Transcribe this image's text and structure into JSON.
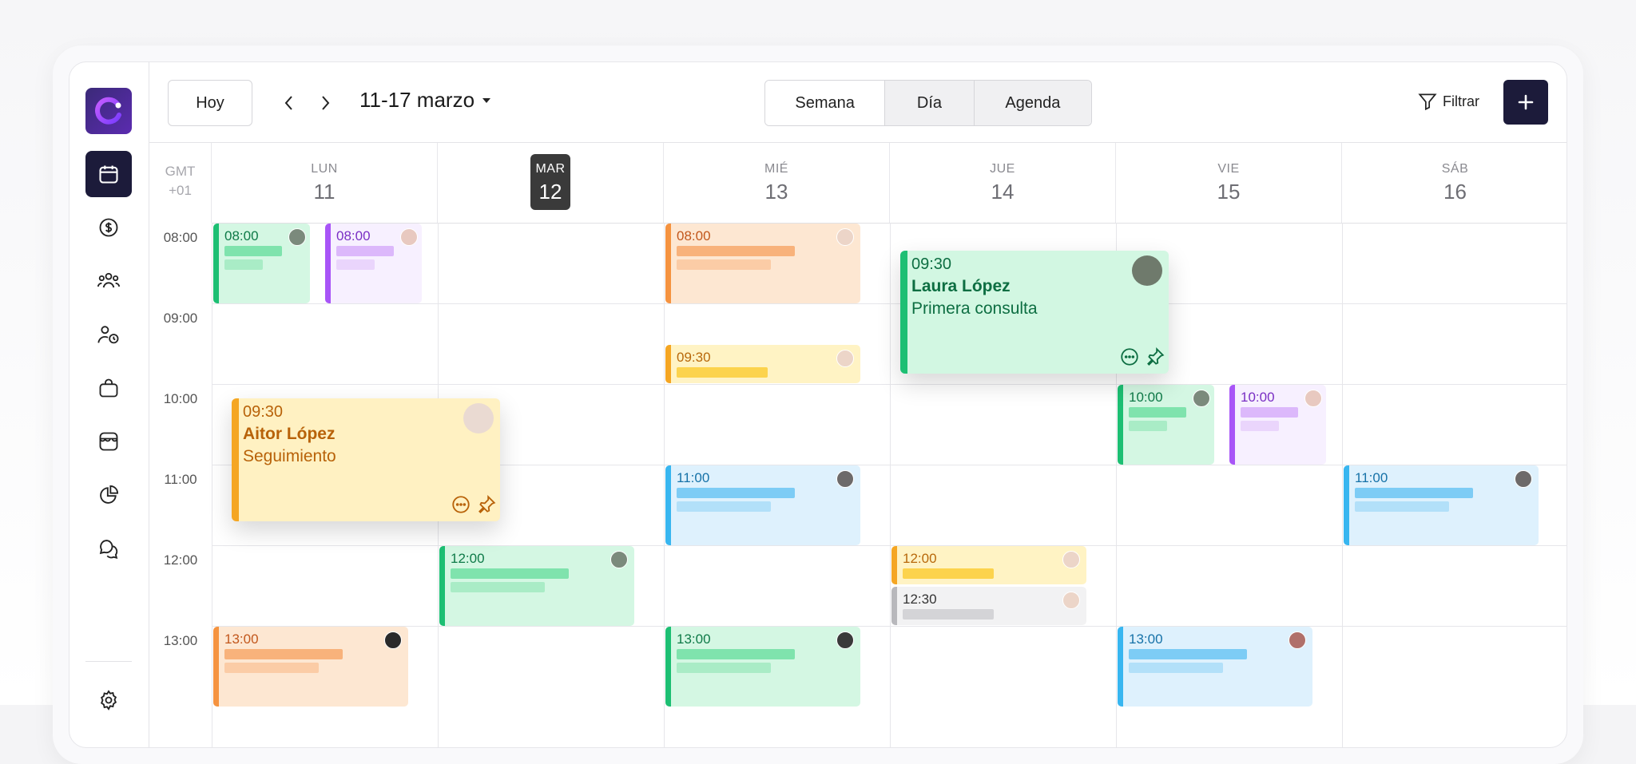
{
  "toolbar": {
    "today_label": "Hoy",
    "range_label": "11-17 marzo",
    "views": [
      "Semana",
      "Día",
      "Agenda"
    ],
    "filter_label": "Filtrar"
  },
  "grid": {
    "gmt_line1": "GMT",
    "gmt_line2": "+01",
    "days": [
      {
        "name": "LUN",
        "date": "11"
      },
      {
        "name": "MAR",
        "date": "12"
      },
      {
        "name": "MIÉ",
        "date": "13"
      },
      {
        "name": "JUE",
        "date": "14"
      },
      {
        "name": "VIE",
        "date": "15"
      },
      {
        "name": "SÁB",
        "date": "16"
      }
    ],
    "hours": [
      "08:00",
      "09:00",
      "10:00",
      "11:00",
      "12:00",
      "13:00"
    ]
  },
  "events": [
    {
      "time": "08:00",
      "day": "LUN",
      "color": "green"
    },
    {
      "time": "08:00",
      "day": "LUN",
      "color": "purple"
    },
    {
      "time": "08:00",
      "day": "MIÉ",
      "color": "orange"
    },
    {
      "time": "09:30",
      "day": "MIÉ",
      "color": "yellow"
    },
    {
      "time": "10:00",
      "day": "VIE",
      "color": "green"
    },
    {
      "time": "10:00",
      "day": "VIE",
      "color": "purple"
    },
    {
      "time": "11:00",
      "day": "MIÉ",
      "color": "blue"
    },
    {
      "time": "11:00",
      "day": "SÁB",
      "color": "blue"
    },
    {
      "time": "12:00",
      "day": "MAR",
      "color": "green"
    },
    {
      "time": "12:00",
      "day": "JUE",
      "color": "yellow"
    },
    {
      "time": "12:30",
      "day": "JUE",
      "color": "gray"
    },
    {
      "time": "13:00",
      "day": "LUN",
      "color": "orange"
    },
    {
      "time": "13:00",
      "day": "MIÉ",
      "color": "green"
    },
    {
      "time": "13:00",
      "day": "VIE",
      "color": "blue"
    }
  ],
  "popups": {
    "aitor": {
      "time": "09:30",
      "name": "Aitor López",
      "subtitle": "Seguimiento"
    },
    "laura": {
      "time": "09:30",
      "name": "Laura López",
      "subtitle": "Primera consulta"
    }
  },
  "colors": {
    "brand_dark": "#1c1b3a",
    "green": "#1dbf73",
    "purple": "#a855f7",
    "orange": "#f59340",
    "yellow": "#f5a623",
    "blue": "#38b6f0",
    "gray": "#b8b8bc"
  },
  "icons": {
    "sidebar": [
      "calendar-icon",
      "dollar-icon",
      "users-icon",
      "user-clock-icon",
      "bag-icon",
      "store-icon",
      "pie-chart-icon",
      "chat-icon",
      "settings-icon"
    ]
  }
}
